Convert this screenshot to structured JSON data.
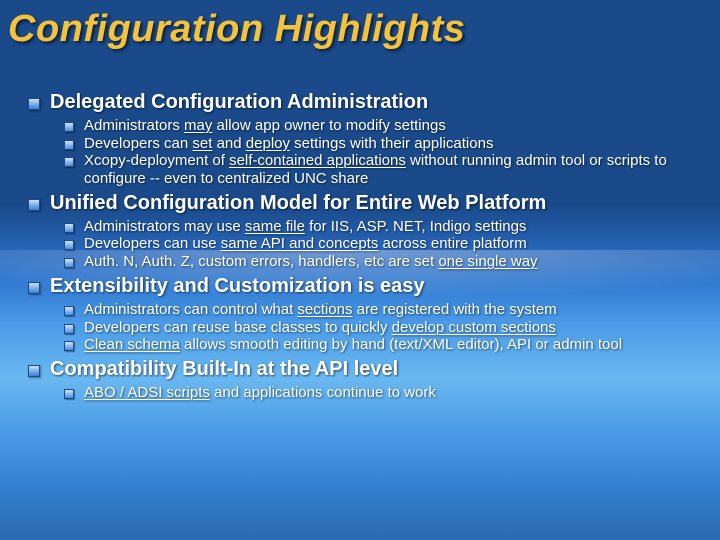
{
  "title": "Configuration Highlights",
  "sections": [
    {
      "heading": "Delegated Configuration Administration",
      "items": [
        {
          "html": "Administrators <span class='u'>may</span> allow app owner to modify settings"
        },
        {
          "html": "Developers can <span class='u'>set</span> and <span class='u'>deploy</span> settings with their applications"
        },
        {
          "html": "Xcopy-deployment of <span class='u'>self-contained applications</span> without running admin tool or scripts to configure -- even to centralized UNC share"
        }
      ]
    },
    {
      "heading": "Unified Configuration Model for Entire Web Platform",
      "items": [
        {
          "html": "Administrators may use <span class='u'>same file</span> for IIS, ASP. NET, Indigo settings"
        },
        {
          "html": "Developers can use <span class='u'>same API and concepts</span> across entire platform"
        },
        {
          "html": "Auth. N, Auth. Z, custom errors, handlers, etc are set <span class='u'>one single way</span>"
        }
      ]
    },
    {
      "heading": "Extensibility and Customization is easy",
      "items": [
        {
          "html": "Administrators can control what <span class='u'>sections</span> are registered with the system"
        },
        {
          "html": "Developers can reuse base classes to quickly <span class='u'>develop custom sections</span>"
        },
        {
          "html": "<span class='u'>Clean schema</span> allows smooth editing by hand (text/XML editor), API or admin tool"
        }
      ]
    },
    {
      "heading": "Compatibility Built-In at the API level",
      "items": [
        {
          "html": "<span class='u'>ABO / ADSI scripts</span> and applications continue to work"
        }
      ]
    }
  ]
}
